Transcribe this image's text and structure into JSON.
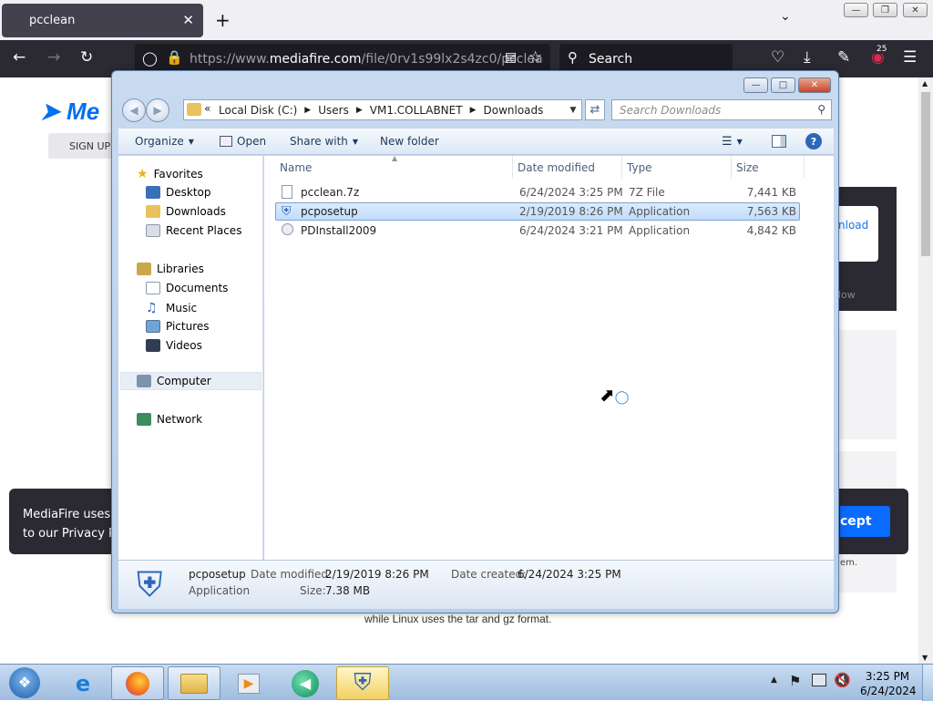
{
  "browser": {
    "tab_title": "pcclean",
    "tab_close": "✕",
    "new_tab": "+",
    "url_prefix": "https://www.",
    "url_domain": "mediafire.com",
    "url_rest": "/file/0rv1s99lx2s4zc0/pcclea",
    "search_placeholder": "Search",
    "badge_count": "25"
  },
  "webpage": {
    "logo_text": "Me",
    "signup_label": "SIGN UP",
    "download_label": "nload",
    "download_hint": "low",
    "cookie_line1": "MediaFire uses c",
    "cookie_line2": "to our Privacy Po",
    "accept_label": "cept",
    "side_text": "em.",
    "linux_text": "while Linux uses the tar and gz format."
  },
  "explorer": {
    "breadcrumb": [
      "Local Disk (C:)",
      "Users",
      "VM1.COLLABNET",
      "Downloads"
    ],
    "breadcrumb_prefix": "«",
    "search_placeholder": "Search Downloads",
    "toolbar": {
      "organize": "Organize",
      "open": "Open",
      "share_with": "Share with",
      "new_folder": "New folder"
    },
    "nav": {
      "favorites": "Favorites",
      "desktop": "Desktop",
      "downloads": "Downloads",
      "recent_places": "Recent Places",
      "libraries": "Libraries",
      "documents": "Documents",
      "music": "Music",
      "pictures": "Pictures",
      "videos": "Videos",
      "computer": "Computer",
      "network": "Network"
    },
    "columns": {
      "name": "Name",
      "date_modified": "Date modified",
      "type": "Type",
      "size": "Size"
    },
    "files": [
      {
        "name": "pcclean.7z",
        "date": "6/24/2024 3:25 PM",
        "type": "7Z File",
        "size": "7,441 KB"
      },
      {
        "name": "pcposetup",
        "date": "2/19/2019 8:26 PM",
        "type": "Application",
        "size": "7,563 KB"
      },
      {
        "name": "PDInstall2009",
        "date": "6/24/2024 3:21 PM",
        "type": "Application",
        "size": "4,842 KB"
      }
    ],
    "details": {
      "name": "pcposetup",
      "type": "Application",
      "date_modified_label": "Date modified:",
      "date_modified": "2/19/2019 8:26 PM",
      "date_created_label": "Date created:",
      "date_created": "6/24/2024 3:25 PM",
      "size_label": "Size:",
      "size": "7.38 MB"
    }
  },
  "taskbar": {
    "time": "3:25 PM",
    "date": "6/24/2024"
  },
  "colors": {
    "firefox_dark": "#2b2a33",
    "accent_blue": "#0a6cff",
    "selection": "#c1dcfc"
  }
}
